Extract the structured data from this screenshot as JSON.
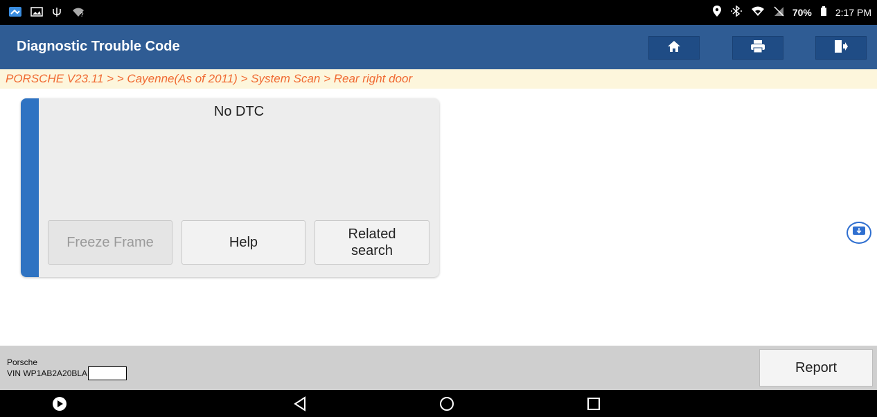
{
  "status_bar": {
    "battery": "70%",
    "time": "2:17 PM",
    "left_icons": [
      "app-icon",
      "image-icon",
      "usb-icon",
      "wifi-unknown-icon"
    ],
    "right_icons": [
      "location-icon",
      "bluetooth-icon",
      "wifi-icon",
      "no-sim-icon",
      "battery-icon"
    ]
  },
  "header": {
    "title": "Diagnostic Trouble Code",
    "buttons": [
      "home-icon",
      "print-icon",
      "exit-icon"
    ]
  },
  "breadcrumb": "PORSCHE V23.11 >  > Cayenne(As of 2011) > System Scan > Rear right door",
  "card": {
    "dtc_text": "No DTC",
    "buttons": {
      "freeze_frame": "Freeze Frame",
      "help": "Help",
      "related_line1": "Related",
      "related_line2": "search"
    }
  },
  "footer": {
    "brand": "Porsche",
    "vin_label": "VIN WP1AB2A20BLA",
    "report_label": "Report"
  },
  "colors": {
    "appbar": "#2f5c94",
    "accent": "#2f73c2",
    "breadcrumb_text": "#f06a32",
    "breadcrumb_bg": "#fdf6dc"
  }
}
